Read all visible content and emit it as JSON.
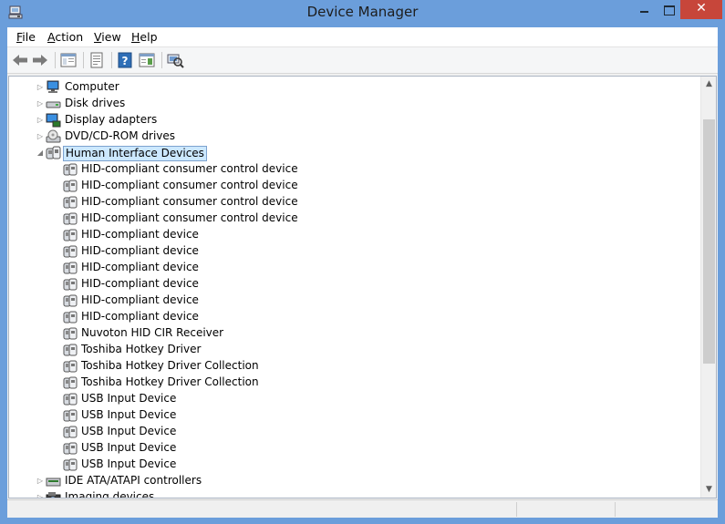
{
  "window": {
    "title": "Device Manager",
    "close_glyph": "✕"
  },
  "menu": [
    {
      "label": "File",
      "accel": "F",
      "rest": "ile"
    },
    {
      "label": "Action",
      "accel": "A",
      "rest": "ction"
    },
    {
      "label": "View",
      "accel": "V",
      "rest": "iew"
    },
    {
      "label": "Help",
      "accel": "H",
      "rest": "elp"
    }
  ],
  "toolbar": {
    "icons": [
      "back-arrow-icon",
      "forward-arrow-icon",
      "show-hide-console-tree-icon",
      "properties-icon",
      "help-icon",
      "action-pane-icon",
      "scan-hardware-icon"
    ]
  },
  "tree": {
    "items": [
      {
        "label": "Computer",
        "level": 0,
        "expander": "▷",
        "icon": "computer-icon"
      },
      {
        "label": "Disk drives",
        "level": 0,
        "expander": "▷",
        "icon": "disk-drive-icon"
      },
      {
        "label": "Display adapters",
        "level": 0,
        "expander": "▷",
        "icon": "display-adapter-icon"
      },
      {
        "label": "DVD/CD-ROM drives",
        "level": 0,
        "expander": "▷",
        "icon": "dvd-drive-icon"
      },
      {
        "label": "Human Interface Devices",
        "level": 0,
        "expander": "◢",
        "icon": "hid-category-icon",
        "selected": true
      },
      {
        "label": "HID-compliant consumer control device",
        "level": 1,
        "icon": "hid-device-icon"
      },
      {
        "label": "HID-compliant consumer control device",
        "level": 1,
        "icon": "hid-device-icon"
      },
      {
        "label": "HID-compliant consumer control device",
        "level": 1,
        "icon": "hid-device-icon"
      },
      {
        "label": "HID-compliant consumer control device",
        "level": 1,
        "icon": "hid-device-icon"
      },
      {
        "label": "HID-compliant device",
        "level": 1,
        "icon": "hid-device-icon"
      },
      {
        "label": "HID-compliant device",
        "level": 1,
        "icon": "hid-device-icon"
      },
      {
        "label": "HID-compliant device",
        "level": 1,
        "icon": "hid-device-icon"
      },
      {
        "label": "HID-compliant device",
        "level": 1,
        "icon": "hid-device-icon"
      },
      {
        "label": "HID-compliant device",
        "level": 1,
        "icon": "hid-device-icon"
      },
      {
        "label": "HID-compliant device",
        "level": 1,
        "icon": "hid-device-icon"
      },
      {
        "label": "Nuvoton HID CIR Receiver",
        "level": 1,
        "icon": "hid-device-icon"
      },
      {
        "label": "Toshiba Hotkey Driver",
        "level": 1,
        "icon": "hid-device-icon"
      },
      {
        "label": "Toshiba Hotkey Driver Collection",
        "level": 1,
        "icon": "hid-device-icon"
      },
      {
        "label": "Toshiba Hotkey Driver Collection",
        "level": 1,
        "icon": "hid-device-icon"
      },
      {
        "label": "USB Input Device",
        "level": 1,
        "icon": "hid-device-icon"
      },
      {
        "label": "USB Input Device",
        "level": 1,
        "icon": "hid-device-icon"
      },
      {
        "label": "USB Input Device",
        "level": 1,
        "icon": "hid-device-icon"
      },
      {
        "label": "USB Input Device",
        "level": 1,
        "icon": "hid-device-icon"
      },
      {
        "label": "USB Input Device",
        "level": 1,
        "icon": "hid-device-icon"
      },
      {
        "label": "IDE ATA/ATAPI controllers",
        "level": 0,
        "expander": "▷",
        "icon": "ide-controller-icon"
      },
      {
        "label": "Imaging devices",
        "level": 0,
        "expander": "▷",
        "icon": "imaging-device-icon"
      }
    ]
  },
  "scrollbar": {
    "up_glyph": "▲",
    "down_glyph": "▼"
  },
  "colors": {
    "title_bar": "#6b9edb",
    "close_button": "#c7463a",
    "selection": "#cce8ff"
  }
}
